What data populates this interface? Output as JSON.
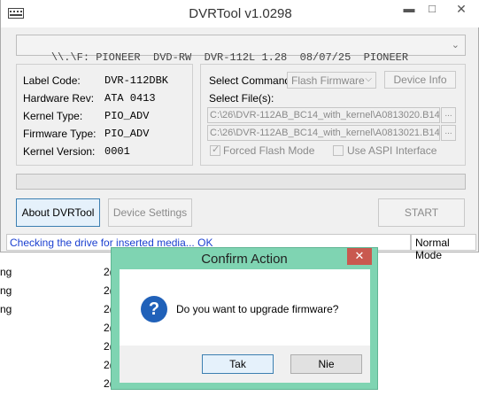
{
  "window": {
    "title": "DVRTool v1.0298",
    "controls": {
      "minimize": "▬",
      "maximize": "□",
      "close": "✕"
    }
  },
  "drive": {
    "selected": "\\\\.\\F: PIONEER  DVD-RW  DVR-112L 1.28  08/07/25  PIONEER"
  },
  "info": {
    "label_code": {
      "label": "Label Code:",
      "value": "DVR-112DBK"
    },
    "hardware_rev": {
      "label": "Hardware Rev:",
      "value": "ATA 0413"
    },
    "kernel_type": {
      "label": "Kernel Type:",
      "value": "PIO_ADV"
    },
    "firmware_type": {
      "label": "Firmware Type:",
      "value": "PIO_ADV"
    },
    "kernel_version": {
      "label": "Kernel Version:",
      "value": "0001"
    }
  },
  "command": {
    "select_label": "Select Command:",
    "selected": "Flash Firmware",
    "device_info_button": "Device Info",
    "files_label": "Select File(s):",
    "file1": "C:\\26\\DVR-112AB_BC14_with_kernel\\A0813020.B14",
    "file2": "C:\\26\\DVR-112AB_BC14_with_kernel\\A0813021.B14",
    "browse": "...",
    "forced_flash": {
      "label": "Forced Flash Mode",
      "checked": true
    },
    "aspi": {
      "label": "Use ASPI Interface",
      "checked": false
    }
  },
  "progress": {
    "value": 0
  },
  "buttons": {
    "about": "About DVRTool",
    "device_settings": "Device Settings",
    "start": "START"
  },
  "status": {
    "message": "Checking the drive for inserted media... OK",
    "mode": "Normal Mode"
  },
  "background_rows": [
    {
      "left": "ng",
      "right": "2("
    },
    {
      "left": "ng",
      "right": "2("
    },
    {
      "left": "ng",
      "right": "2("
    },
    {
      "left": "",
      "right": "2("
    },
    {
      "left": "",
      "right": "2("
    },
    {
      "left": "",
      "right": "2("
    },
    {
      "left": "",
      "right": "2("
    }
  ],
  "dialog": {
    "title": "Confirm Action",
    "close": "✕",
    "message": "Do you want to upgrade firmware?",
    "yes": "Tak",
    "no": "Nie"
  },
  "colors": {
    "dialog_frame": "#7fd4b2",
    "dialog_close": "#c9594f",
    "status_text": "#1a3fd0",
    "question_icon": "#2061b9"
  }
}
